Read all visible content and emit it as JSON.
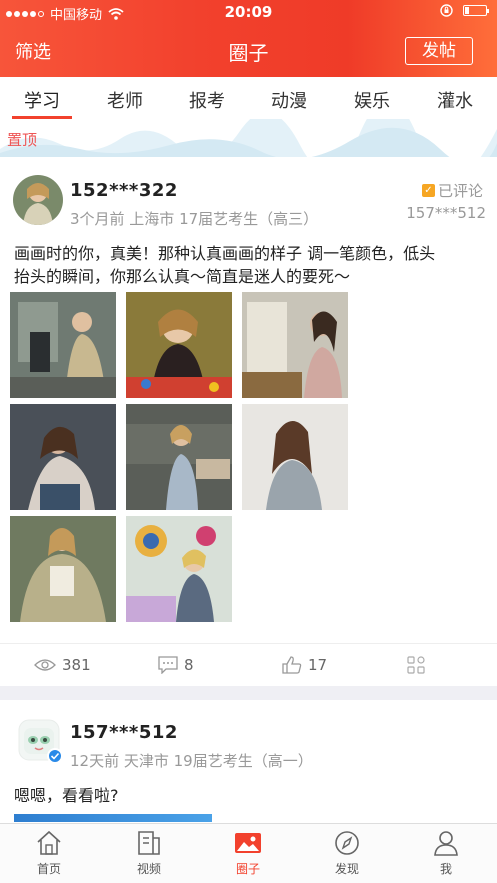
{
  "status_bar": {
    "carrier": "中国移动",
    "time": "20:09",
    "battery_level": 0.2
  },
  "header": {
    "filter_label": "筛选",
    "title": "圈子",
    "post_button_label": "发帖"
  },
  "tabs": [
    {
      "label": "学习",
      "active": true
    },
    {
      "label": "老师",
      "active": false
    },
    {
      "label": "报考",
      "active": false
    },
    {
      "label": "动漫",
      "active": false
    },
    {
      "label": "娱乐",
      "active": false
    },
    {
      "label": "灌水",
      "active": false
    }
  ],
  "pinned_label": "置顶",
  "post1": {
    "username": "152***322",
    "meta": "3个月前 上海市 17届艺考生（高三）",
    "commented_label": "已评论",
    "commented_by": "157***512",
    "text_line1": "画画时的你，真美！那种认真画画的样子 调一笔颜色，低头",
    "text_line2": "抬头的瞬间，你那么认真～简直是迷人的要死～",
    "views": "381",
    "comments": "8",
    "likes": "17"
  },
  "post2": {
    "username": "157***512",
    "meta": "12天前 天津市 19届艺考生（高一）",
    "text": "嗯嗯，看看啦?"
  },
  "bottom_nav": [
    {
      "label": "首页",
      "icon": "home-icon",
      "active": false
    },
    {
      "label": "视频",
      "icon": "video-icon",
      "active": false
    },
    {
      "label": "圈子",
      "icon": "circle-photo-icon",
      "active": true
    },
    {
      "label": "发现",
      "icon": "compass-icon",
      "active": false
    },
    {
      "label": "我",
      "icon": "person-icon",
      "active": false
    }
  ],
  "colors": {
    "accent": "#f2412d",
    "muted_text": "#999999"
  }
}
